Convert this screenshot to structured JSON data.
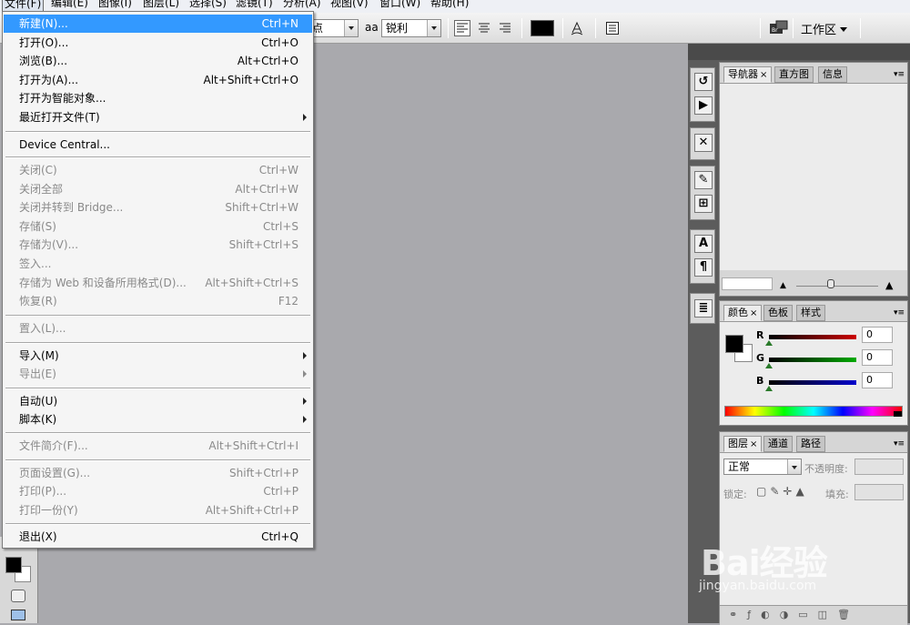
{
  "menubar": [
    {
      "label": "文件(F)",
      "active": true
    },
    {
      "label": "编辑(E)"
    },
    {
      "label": "图像(I)"
    },
    {
      "label": "图层(L)"
    },
    {
      "label": "选择(S)"
    },
    {
      "label": "滤镜(T)"
    },
    {
      "label": "分析(A)"
    },
    {
      "label": "视图(V)"
    },
    {
      "label": "窗口(W)"
    },
    {
      "label": "帮助(H)"
    }
  ],
  "options_bar": {
    "font_style_fragment": "点",
    "aa_label": "aa",
    "antialias_value": "锐利",
    "workspace_label": "工作区"
  },
  "file_menu": {
    "items": [
      {
        "label": "新建(N)...",
        "shortcut": "Ctrl+N",
        "highlighted": true
      },
      {
        "label": "打开(O)...",
        "shortcut": "Ctrl+O"
      },
      {
        "label": "浏览(B)...",
        "shortcut": "Alt+Ctrl+O"
      },
      {
        "label": "打开为(A)...",
        "shortcut": "Alt+Shift+Ctrl+O"
      },
      {
        "label": "打开为智能对象...",
        "shortcut": ""
      },
      {
        "label": "最近打开文件(T)",
        "shortcut": "",
        "submenu": true
      },
      {
        "label": "Device Central...",
        "shortcut": ""
      },
      {
        "label": "关闭(C)",
        "shortcut": "Ctrl+W",
        "disabled": true
      },
      {
        "label": "关闭全部",
        "shortcut": "Alt+Ctrl+W",
        "disabled": true
      },
      {
        "label": "关闭并转到 Bridge...",
        "shortcut": "Shift+Ctrl+W",
        "disabled": true
      },
      {
        "label": "存储(S)",
        "shortcut": "Ctrl+S",
        "disabled": true
      },
      {
        "label": "存储为(V)...",
        "shortcut": "Shift+Ctrl+S",
        "disabled": true
      },
      {
        "label": "签入...",
        "shortcut": "",
        "disabled": true
      },
      {
        "label": "存储为 Web 和设备所用格式(D)...",
        "shortcut": "Alt+Shift+Ctrl+S",
        "disabled": true
      },
      {
        "label": "恢复(R)",
        "shortcut": "F12",
        "disabled": true
      },
      {
        "label": "置入(L)...",
        "shortcut": "",
        "disabled": true
      },
      {
        "label": "导入(M)",
        "shortcut": "",
        "submenu": true
      },
      {
        "label": "导出(E)",
        "shortcut": "",
        "submenu": true,
        "disabled": true
      },
      {
        "label": "自动(U)",
        "shortcut": "",
        "submenu": true
      },
      {
        "label": "脚本(K)",
        "shortcut": "",
        "submenu": true
      },
      {
        "label": "文件简介(F)...",
        "shortcut": "Alt+Shift+Ctrl+I",
        "disabled": true
      },
      {
        "label": "页面设置(G)...",
        "shortcut": "Shift+Ctrl+P",
        "disabled": true
      },
      {
        "label": "打印(P)...",
        "shortcut": "Ctrl+P",
        "disabled": true
      },
      {
        "label": "打印一份(Y)",
        "shortcut": "Alt+Shift+Ctrl+P",
        "disabled": true
      },
      {
        "label": "退出(X)",
        "shortcut": "Ctrl+Q"
      }
    ]
  },
  "dock_icons": [
    "history-icon",
    "actions-icon",
    "tool-presets-icon",
    "brushes-icon",
    "clone-source-icon",
    "character-icon",
    "paragraph-icon",
    "layer-comps-icon"
  ],
  "navigator_panel": {
    "tabs": [
      {
        "label": "导航器",
        "close": "×"
      },
      {
        "label": "直方图"
      },
      {
        "label": "信息"
      }
    ]
  },
  "color_panel": {
    "tabs": [
      {
        "label": "颜色",
        "close": "×"
      },
      {
        "label": "色板"
      },
      {
        "label": "样式"
      }
    ],
    "channels": [
      {
        "label": "R",
        "value": "0",
        "color": "#cc0000"
      },
      {
        "label": "G",
        "value": "0",
        "color": "#00aa00"
      },
      {
        "label": "B",
        "value": "0",
        "color": "#0000cc"
      }
    ]
  },
  "layers_panel": {
    "tabs": [
      {
        "label": "图层",
        "close": "×"
      },
      {
        "label": "通道"
      },
      {
        "label": "路径"
      }
    ],
    "blend_mode": "正常",
    "opacity_label": "不透明度:",
    "lock_label": "锁定:",
    "fill_label": "填充:"
  },
  "watermark": {
    "brand": "Bai经验",
    "url": "jingyan.baidu.com"
  }
}
